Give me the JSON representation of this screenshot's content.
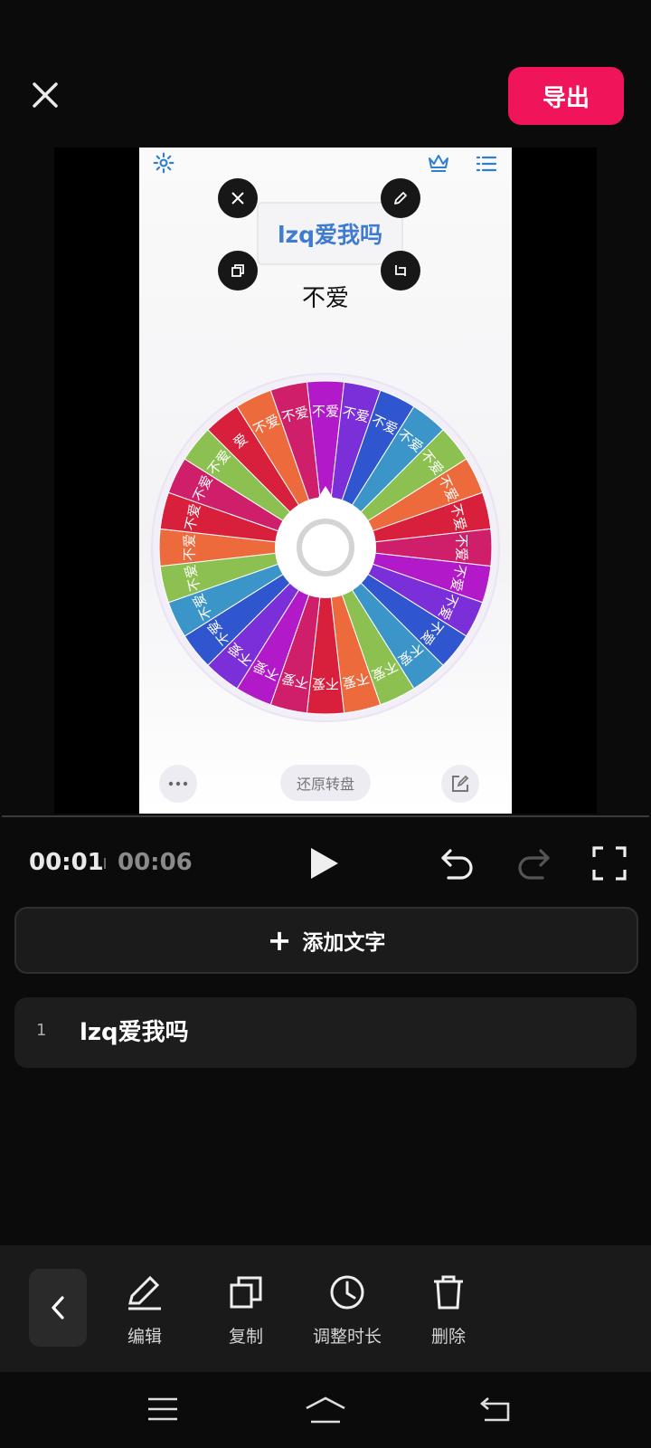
{
  "header": {
    "close_icon": "close-icon",
    "export_label": "导出",
    "export_color": "#f0155a"
  },
  "preview": {
    "sticker_text": "lzq爱我吗",
    "result_text": "不爱",
    "reset_label": "还原转盘",
    "wheel_labels": [
      "不爱",
      "不爱",
      "不爱",
      "不爱",
      "不爱",
      "不爱",
      "不爱",
      "不爱",
      "不爱",
      "不爱",
      "不爱",
      "不爱",
      "不爱",
      "不爱",
      "不爱",
      "不爱",
      "不爱",
      "不爱",
      "不爱",
      "不爱",
      "不爱",
      "不爱",
      "不爱",
      "不爱",
      "不爱",
      "爱",
      "不爱",
      "不爱"
    ],
    "wheel_colors": [
      "#b21ac9",
      "#7a2fd8",
      "#2f55cf",
      "#3c95c9",
      "#8cc152",
      "#ec6a3c",
      "#d81f3c",
      "#cf1f6a",
      "#b21ac9",
      "#7a2fd8",
      "#2f55cf",
      "#3c95c9",
      "#8cc152",
      "#ec6a3c",
      "#d81f3c",
      "#cf1f6a",
      "#b21ac9",
      "#7a2fd8",
      "#2f55cf",
      "#3c95c9",
      "#8cc152",
      "#ec6a3c",
      "#d81f3c",
      "#cf1f6a",
      "#8cc152",
      "#d81f3c",
      "#ec6a3c",
      "#cf1f6a"
    ]
  },
  "playback": {
    "current_time": "00:01",
    "total_time": "00:06"
  },
  "add_text_label": "添加文字",
  "text_items": [
    {
      "index": "1",
      "label": "lzq爱我吗"
    }
  ],
  "toolbar": {
    "edit_label": "编辑",
    "copy_label": "复制",
    "duration_label": "调整时长",
    "delete_label": "删除"
  }
}
